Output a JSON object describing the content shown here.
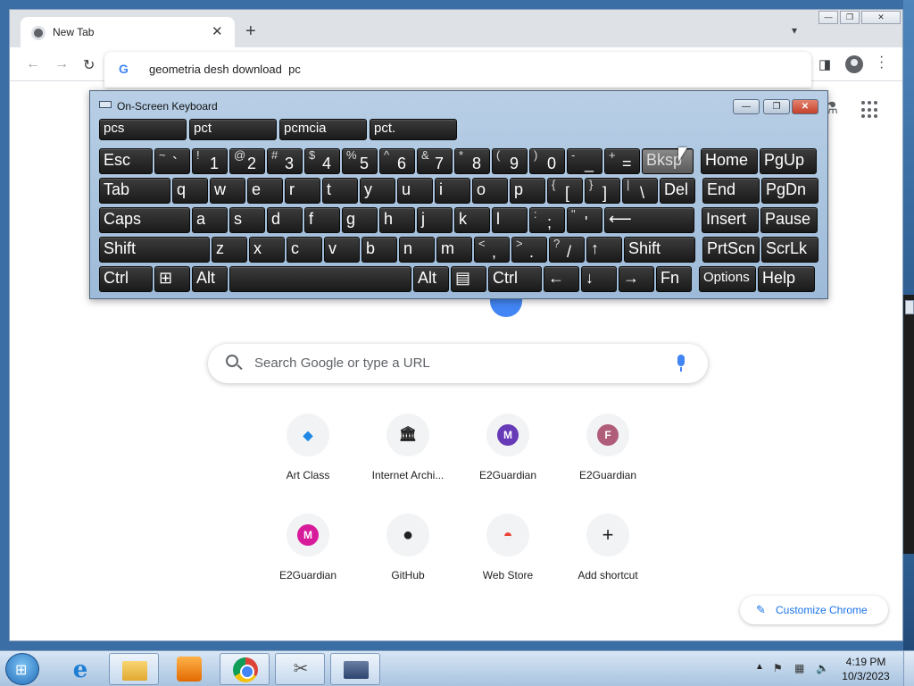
{
  "browser": {
    "tab_title": "New Tab",
    "omnibox_text": "geometria desh download  pc",
    "search_placeholder": "Search Google or type a URL",
    "customize_label": "Customize Chrome",
    "window_controls": [
      "—",
      "❐",
      "✕"
    ],
    "shortcuts": [
      {
        "label": "Art Class",
        "icon": "art-class-icon",
        "glyph": "◆",
        "color": "#1e88e5"
      },
      {
        "label": "Internet Archi...",
        "icon": "internet-archive-icon",
        "glyph": "🏛",
        "color": "#222222"
      },
      {
        "label": "E2Guardian",
        "icon": "m-letter-icon",
        "glyph": "M",
        "color": "#673ab7"
      },
      {
        "label": "E2Guardian",
        "icon": "f-letter-icon",
        "glyph": "F",
        "color": "#b05d7a"
      },
      {
        "label": "E2Guardian",
        "icon": "m-letter-icon",
        "glyph": "M",
        "color": "#d81b9b"
      },
      {
        "label": "GitHub",
        "icon": "github-icon",
        "glyph": "●",
        "color": "#202124"
      },
      {
        "label": "Web Store",
        "icon": "web-store-icon",
        "glyph": "◓",
        "color": "#ea4335"
      },
      {
        "label": "Add shortcut",
        "icon": "plus-icon",
        "glyph": "+",
        "color": "#202124"
      }
    ]
  },
  "osk": {
    "title": "On-Screen Keyboard",
    "title_buttons": [
      "—",
      "❐",
      "✕"
    ],
    "predictions": [
      "pcs",
      "pct",
      "pcmcia",
      "pct."
    ],
    "rows": [
      [
        {
          "k": "Esc"
        },
        {
          "s": "~",
          "m": "`"
        },
        {
          "s": "!",
          "m": "1"
        },
        {
          "s": "@",
          "m": "2"
        },
        {
          "s": "#",
          "m": "3"
        },
        {
          "s": "$",
          "m": "4"
        },
        {
          "s": "%",
          "m": "5"
        },
        {
          "s": "^",
          "m": "6"
        },
        {
          "s": "&",
          "m": "7"
        },
        {
          "s": "*",
          "m": "8"
        },
        {
          "s": "(",
          "m": "9"
        },
        {
          "s": ")",
          "m": "0"
        },
        {
          "s": "-",
          "m": "_"
        },
        {
          "s": "+",
          "m": "="
        },
        {
          "k": "Bksp"
        },
        {
          "k": "Home"
        },
        {
          "k": "PgUp"
        }
      ],
      [
        {
          "k": "Tab"
        },
        {
          "k": "q"
        },
        {
          "k": "w"
        },
        {
          "k": "e"
        },
        {
          "k": "r"
        },
        {
          "k": "t"
        },
        {
          "k": "y"
        },
        {
          "k": "u"
        },
        {
          "k": "i"
        },
        {
          "k": "o"
        },
        {
          "k": "p"
        },
        {
          "s": "{",
          "m": "["
        },
        {
          "s": "}",
          "m": "]"
        },
        {
          "s": "|",
          "m": "\\"
        },
        {
          "k": "Del"
        },
        {
          "k": "End"
        },
        {
          "k": "PgDn"
        }
      ],
      [
        {
          "k": "Caps"
        },
        {
          "k": "a"
        },
        {
          "k": "s"
        },
        {
          "k": "d"
        },
        {
          "k": "f"
        },
        {
          "k": "g"
        },
        {
          "k": "h"
        },
        {
          "k": "j"
        },
        {
          "k": "k"
        },
        {
          "k": "l"
        },
        {
          "s": ":",
          "m": ";"
        },
        {
          "s": "\"",
          "m": "'"
        },
        {
          "k": "⟵"
        },
        {
          "k": "Insert"
        },
        {
          "k": "Pause"
        }
      ],
      [
        {
          "k": "Shift"
        },
        {
          "k": "z"
        },
        {
          "k": "x"
        },
        {
          "k": "c"
        },
        {
          "k": "v"
        },
        {
          "k": "b"
        },
        {
          "k": "n"
        },
        {
          "k": "m"
        },
        {
          "s": "<",
          "m": ","
        },
        {
          "s": ">",
          "m": "."
        },
        {
          "s": "?",
          "m": "/"
        },
        {
          "k": "↑"
        },
        {
          "k": "Shift"
        },
        {
          "k": "PrtScn"
        },
        {
          "k": "ScrLk"
        }
      ],
      [
        {
          "k": "Ctrl"
        },
        {
          "k": "⊞"
        },
        {
          "k": "Alt"
        },
        {
          "k": ""
        },
        {
          "k": "Alt"
        },
        {
          "k": "▤"
        },
        {
          "k": "Ctrl"
        },
        {
          "k": "←"
        },
        {
          "k": "↓"
        },
        {
          "k": "→"
        },
        {
          "k": "Fn"
        },
        {
          "k": "Options"
        },
        {
          "k": "Help"
        }
      ]
    ]
  },
  "taskbar": {
    "time": "4:19 PM",
    "date": "10/3/2023",
    "items": [
      "internet-explorer-icon",
      "file-explorer-icon",
      "media-player-icon",
      "chrome-icon",
      "tool-icon",
      "on-screen-keyboard-icon"
    ]
  }
}
